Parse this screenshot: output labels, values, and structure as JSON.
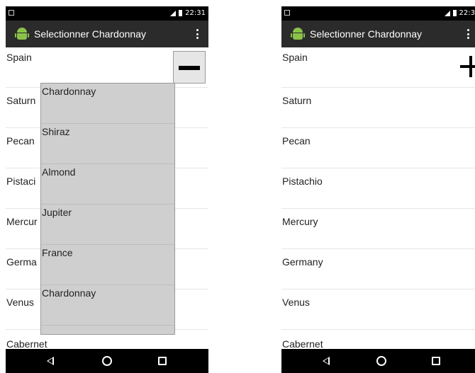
{
  "left_screen": {
    "status": {
      "time": "22:31"
    },
    "app_title": "Selectionner Chardonnay",
    "list_items": [
      "Spain",
      "Saturn",
      "Pecan",
      "Pistaci",
      "Mercur",
      "Germa",
      "Venus",
      "Cabernet"
    ],
    "toggle_symbol": "minus",
    "dropdown_items": [
      "Chardonnay",
      "Shiraz",
      "Almond",
      "Jupiter",
      "France",
      "Chardonnay"
    ]
  },
  "right_screen": {
    "status": {
      "time": "22:3"
    },
    "app_title": "Selectionner Chardonnay",
    "list_items": [
      "Spain",
      "Saturn",
      "Pecan",
      "Pistachio",
      "Mercury",
      "Germany",
      "Venus",
      "Cabernet"
    ],
    "toggle_symbol": "plus"
  },
  "icons": {
    "app_icon": "android-icon",
    "menu": "overflow-menu-icon",
    "back": "back-icon",
    "home": "home-icon",
    "recent": "recent-apps-icon"
  },
  "colors": {
    "action_bar": "#2b2b2b",
    "status_bar": "#000000",
    "dropdown_bg": "#cfcfcf",
    "android_green": "#8bc34a"
  }
}
